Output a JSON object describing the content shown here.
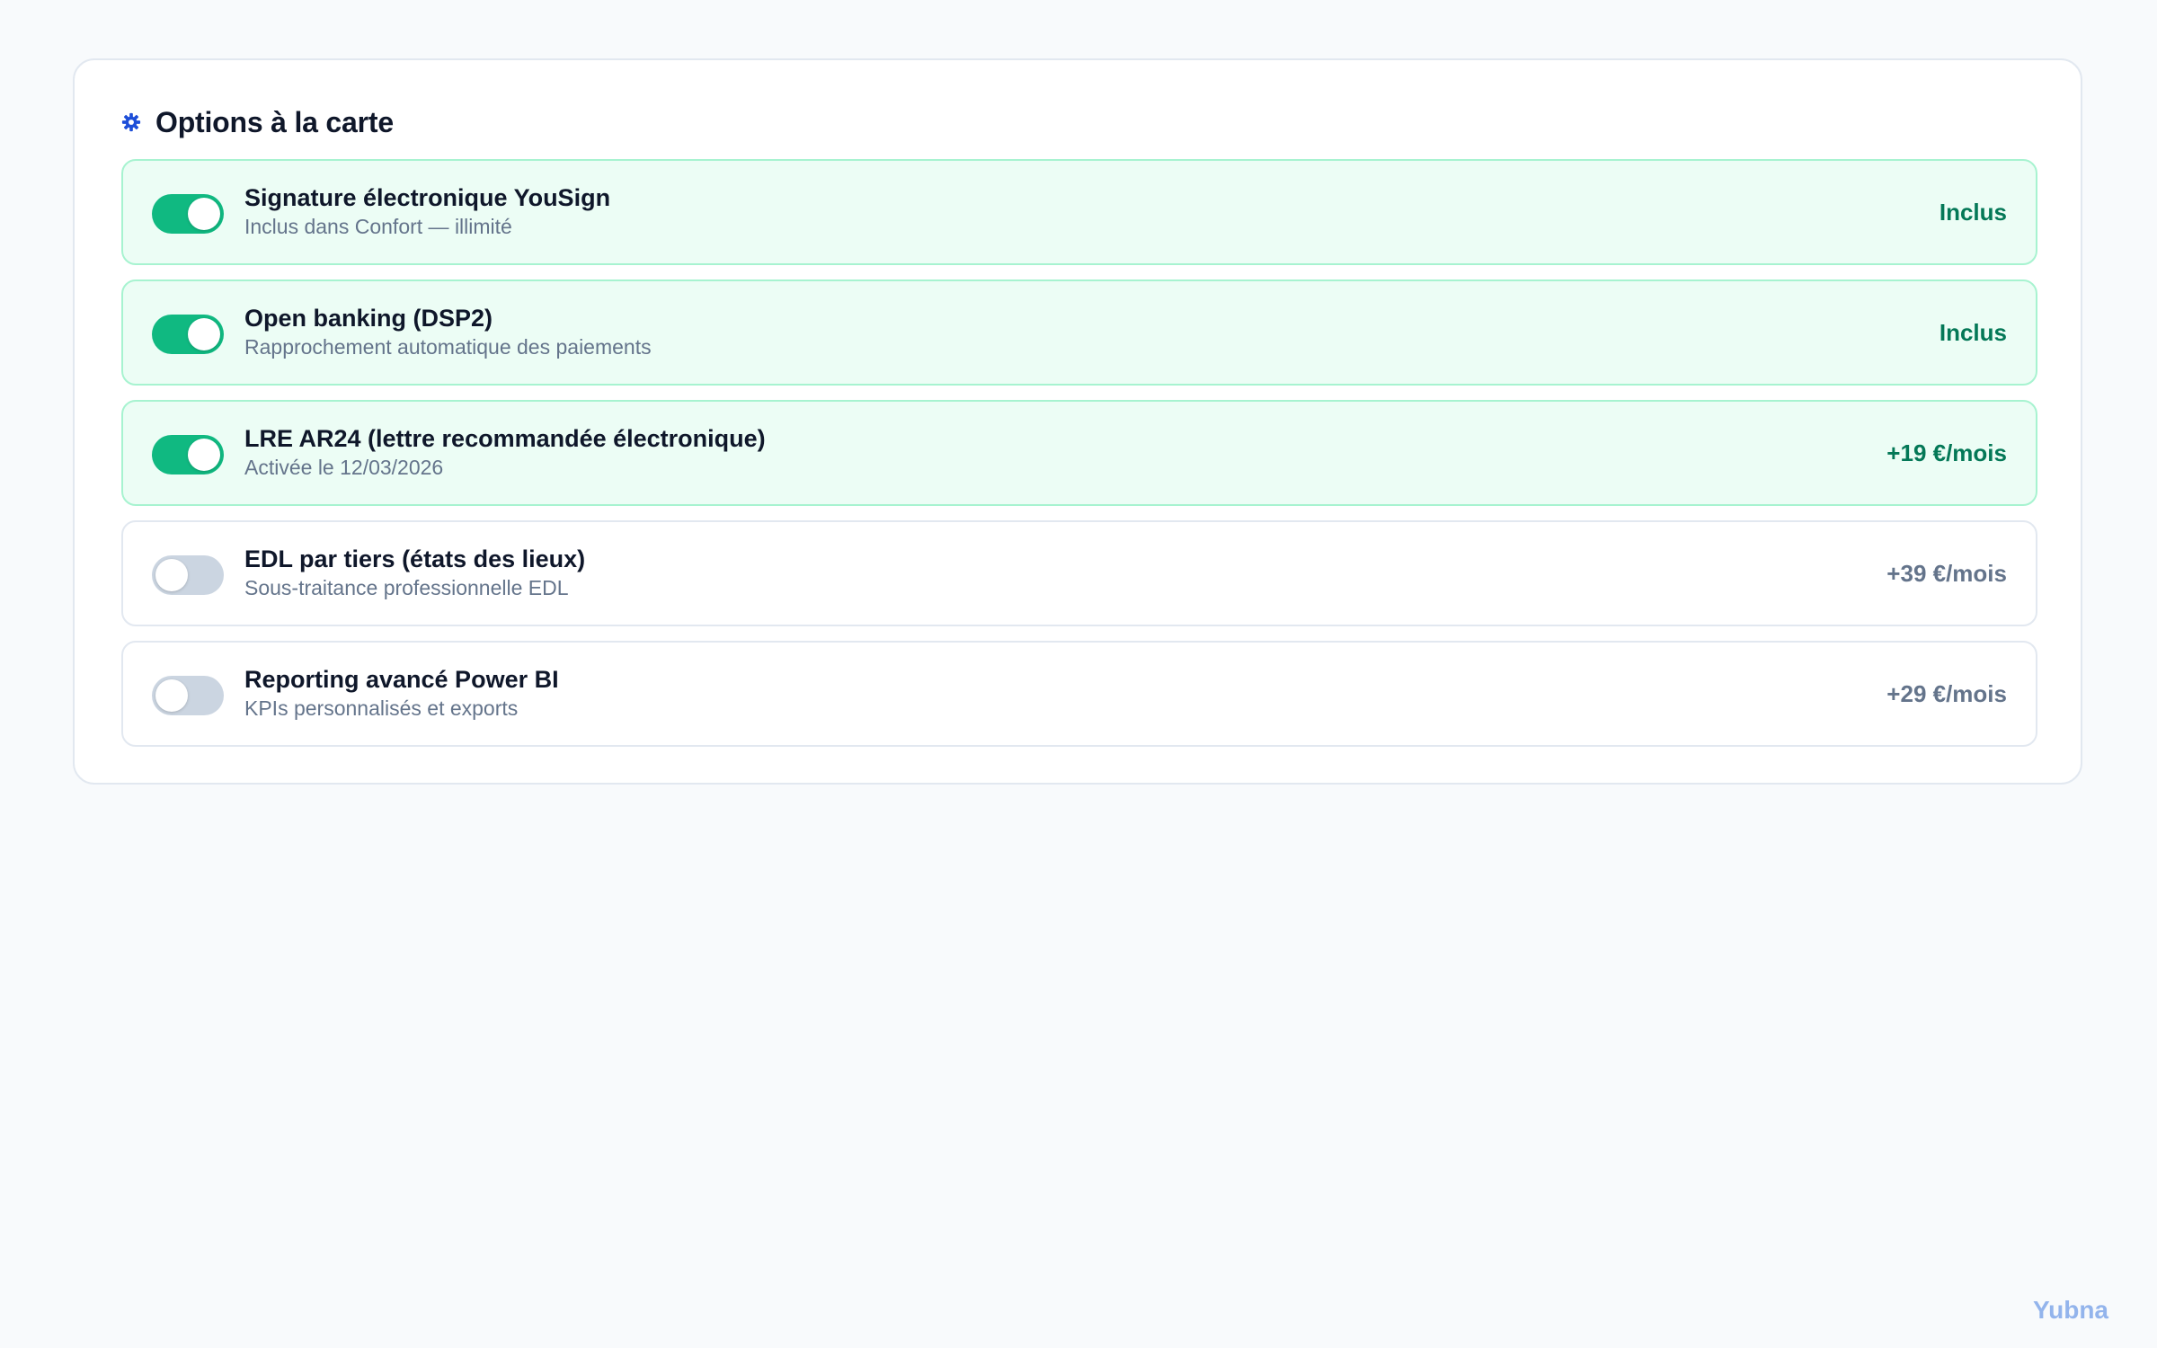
{
  "section": {
    "title": "Options à la carte",
    "icon": "gear-icon",
    "accent_color": "#1d4ed8"
  },
  "options": [
    {
      "title": "Signature électronique YouSign",
      "subtitle": "Inclus dans Confort — illimité",
      "price": "Inclus",
      "enabled": true
    },
    {
      "title": "Open banking (DSP2)",
      "subtitle": "Rapprochement automatique des paiements",
      "price": "Inclus",
      "enabled": true
    },
    {
      "title": "LRE AR24 (lettre recommandée électronique)",
      "subtitle": "Activée le 12/03/2026",
      "price": "+19 €/mois",
      "enabled": true
    },
    {
      "title": "EDL par tiers (états des lieux)",
      "subtitle": "Sous-traitance professionnelle EDL",
      "price": "+39 €/mois",
      "enabled": false
    },
    {
      "title": "Reporting avancé Power BI",
      "subtitle": "KPIs personnalisés et exports",
      "price": "+29 €/mois",
      "enabled": false
    }
  ],
  "colors": {
    "active_bg": "#ecfdf5",
    "active_border": "#a7f3d0",
    "toggle_on": "#10b981",
    "toggle_off": "#cbd5e1",
    "price_active": "#047857",
    "price_inactive": "#64748b"
  },
  "brand": {
    "name": "Yubna"
  }
}
